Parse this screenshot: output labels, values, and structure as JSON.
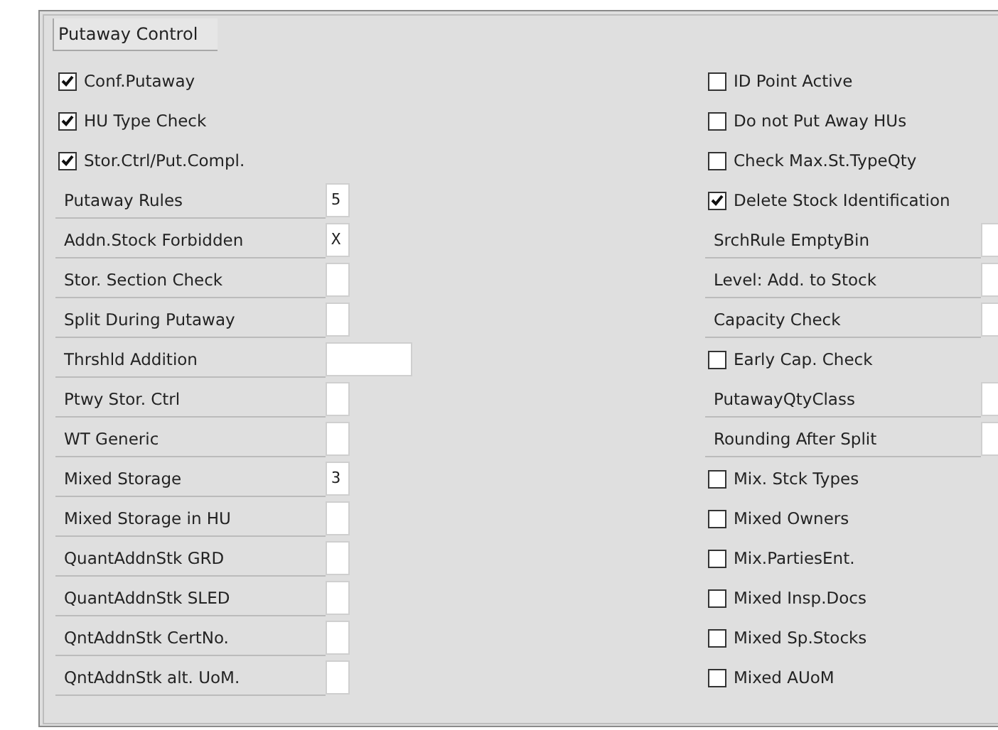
{
  "group": {
    "title": "Putaway Control"
  },
  "left": [
    {
      "kind": "checkbox",
      "label": "Conf.Putaway",
      "checked": true
    },
    {
      "kind": "checkbox",
      "label": "HU Type Check",
      "checked": true
    },
    {
      "kind": "checkbox",
      "label": "Stor.Ctrl/Put.Compl.",
      "checked": true
    },
    {
      "kind": "field",
      "label": "Putaway Rules",
      "value": "5"
    },
    {
      "kind": "field",
      "label": "Addn.Stock Forbidden",
      "value": "X"
    },
    {
      "kind": "field",
      "label": "Stor. Section Check"
    },
    {
      "kind": "field",
      "label": "Split During Putaway"
    },
    {
      "kind": "long-field",
      "label": "Thrshld Addition"
    },
    {
      "kind": "field",
      "label": "Ptwy Stor. Ctrl"
    },
    {
      "kind": "field",
      "label": "WT Generic"
    },
    {
      "kind": "field",
      "label": "Mixed Storage",
      "value": "3"
    },
    {
      "kind": "field",
      "label": "Mixed Storage in HU"
    },
    {
      "kind": "field",
      "label": "QuantAddnStk GRD"
    },
    {
      "kind": "field",
      "label": "QuantAddnStk SLED"
    },
    {
      "kind": "field",
      "label": "QntAddnStk CertNo."
    },
    {
      "kind": "field",
      "label": "QntAddnStk alt. UoM."
    }
  ],
  "right": [
    {
      "kind": "checkbox",
      "label": "ID Point Active",
      "checked": false
    },
    {
      "kind": "checkbox",
      "label": "Do not Put Away HUs",
      "checked": false
    },
    {
      "kind": "checkbox",
      "label": "Check Max.St.TypeQty",
      "checked": false
    },
    {
      "kind": "checkbox",
      "label": "Delete Stock Identification",
      "checked": true
    },
    {
      "kind": "field",
      "label": "SrchRule EmptyBin"
    },
    {
      "kind": "field",
      "label": "Level: Add. to Stock"
    },
    {
      "kind": "field",
      "label": "Capacity Check"
    },
    {
      "kind": "checkbox",
      "label": "Early Cap. Check",
      "checked": false
    },
    {
      "kind": "field",
      "label": "PutawayQtyClass"
    },
    {
      "kind": "field",
      "label": "Rounding After Split"
    },
    {
      "kind": "checkbox",
      "label": "Mix. Stck Types",
      "checked": false
    },
    {
      "kind": "checkbox",
      "label": "Mixed Owners",
      "checked": false
    },
    {
      "kind": "checkbox",
      "label": "Mix.PartiesEnt.",
      "checked": false
    },
    {
      "kind": "checkbox",
      "label": "Mixed Insp.Docs",
      "checked": false
    },
    {
      "kind": "checkbox",
      "label": "Mixed Sp.Stocks",
      "checked": false
    },
    {
      "kind": "checkbox",
      "label": "Mixed AUoM",
      "checked": false
    }
  ]
}
